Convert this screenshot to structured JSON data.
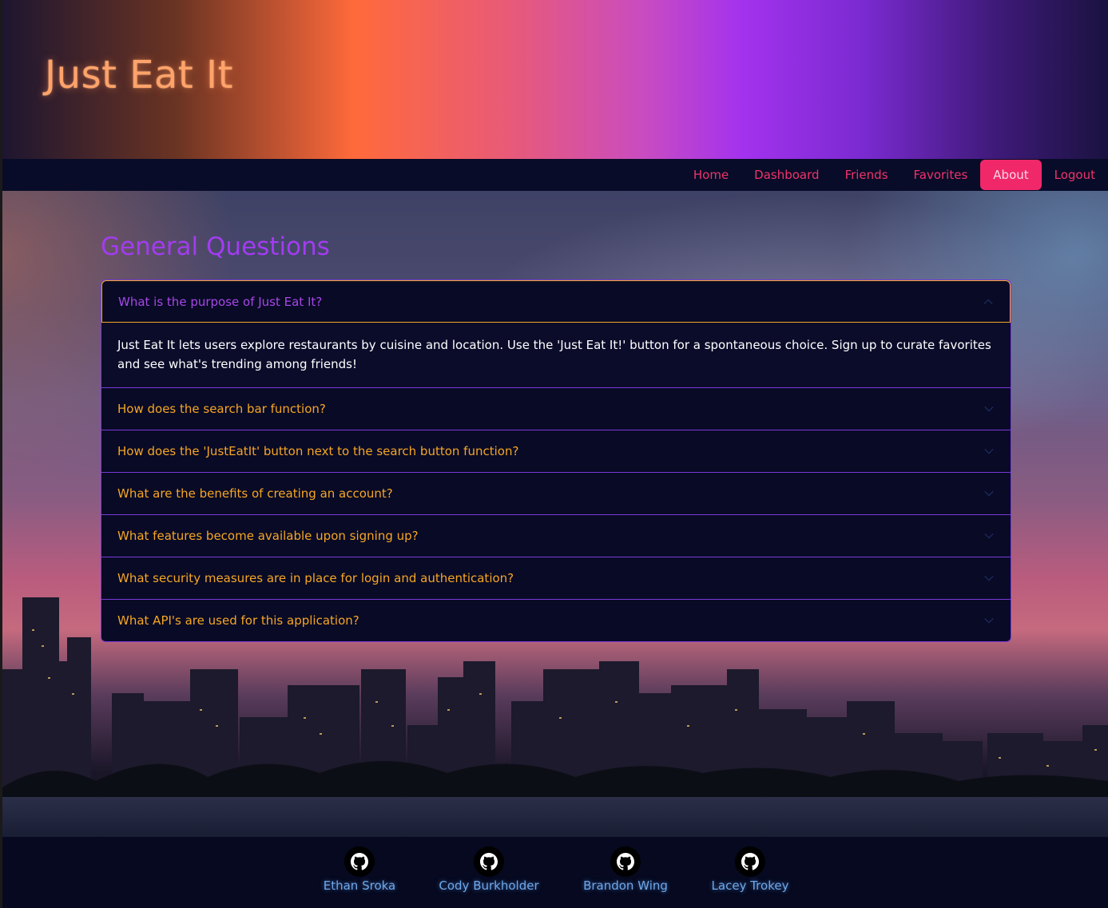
{
  "app": {
    "brand": "Just Eat It"
  },
  "nav": {
    "items": [
      {
        "label": "Home",
        "active": false
      },
      {
        "label": "Dashboard",
        "active": false
      },
      {
        "label": "Friends",
        "active": false
      },
      {
        "label": "Favorites",
        "active": false
      },
      {
        "label": "About",
        "active": true
      },
      {
        "label": "Logout",
        "active": false
      }
    ]
  },
  "faq": {
    "title": "General Questions",
    "items": [
      {
        "question": "What is the purpose of Just Eat It?",
        "open": true,
        "answer": "Just Eat It lets users explore restaurants by cuisine and location. Use the 'Just Eat It!' button for a spontaneous choice. Sign up to curate favorites and see what's trending among friends!"
      },
      {
        "question": "How does the search bar function?",
        "open": false
      },
      {
        "question": "How does the 'JustEatIt' button next to the search button function?",
        "open": false
      },
      {
        "question": "What are the benefits of creating an account?",
        "open": false
      },
      {
        "question": "What features become available upon signing up?",
        "open": false
      },
      {
        "question": "What security measures are in place for login and authentication?",
        "open": false
      },
      {
        "question": "What API's are used for this application?",
        "open": false
      }
    ]
  },
  "footer": {
    "members": [
      {
        "name": "Ethan Sroka",
        "icon": "github-icon"
      },
      {
        "name": "Cody Burkholder",
        "icon": "github-icon"
      },
      {
        "name": "Brandon Wing",
        "icon": "github-icon"
      },
      {
        "name": "Lacey Trokey",
        "icon": "github-icon"
      }
    ]
  },
  "colors": {
    "nav_link": "#f0336b",
    "nav_active_bg": "#f0286a",
    "faq_title": "#a23cf0",
    "question": "#f6a623",
    "open_question": "#a847e6",
    "accordion_border": "#7a3ad8",
    "footer_name": "#6ea8e8"
  }
}
